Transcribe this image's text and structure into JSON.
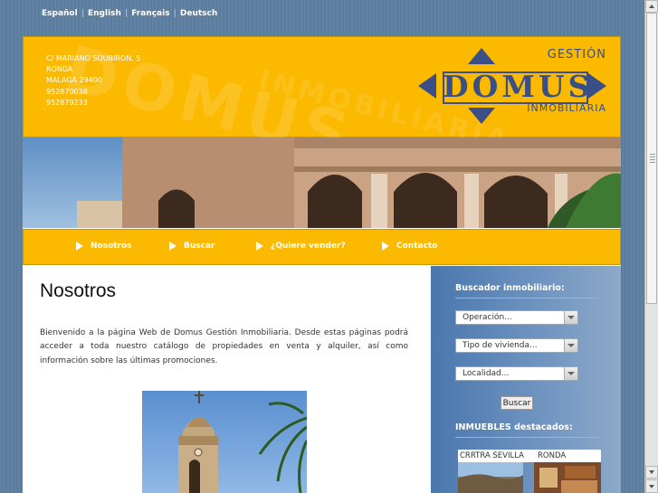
{
  "languages": [
    "Español",
    "English",
    "Français",
    "Deutsch"
  ],
  "address": {
    "street": "C/ MARIANO SOUBIRON, 5",
    "city": "RONDA",
    "postal": "MALAGA 29400",
    "phone1": "952870038",
    "phone2": "952879233"
  },
  "logo": {
    "top": "GESTIÓN",
    "word": "DOMUS",
    "bottom": "INMOBILIARIA"
  },
  "watermark": {
    "big": "DOMUS",
    "small": "INMOBILIARIA"
  },
  "nav": [
    "Nosotros",
    "Buscar",
    "¿Quiere vender?",
    "Contacto"
  ],
  "main": {
    "title": "Nosotros",
    "intro": "Bienvenido a la página Web de Domus Gestión Inmobiliaria. Desde estas páginas podrá acceder a toda nuestro catálogo de propiedades en venta y alquiler, así como información sobre las últimas promociones."
  },
  "sidebar": {
    "search_title": "Buscador inmobiliario:",
    "selects": [
      "Operación...",
      "Tipo de vivienda...",
      "Localidad..."
    ],
    "search_button": "Buscar",
    "featured_title": "INMUEBLES destacados:",
    "featured": [
      "CRRTRA SEVILLA",
      "RONDA"
    ]
  },
  "colors": {
    "accent": "#fbb900",
    "logo": "#3a4f86",
    "sidebar": "#4a77ad"
  }
}
